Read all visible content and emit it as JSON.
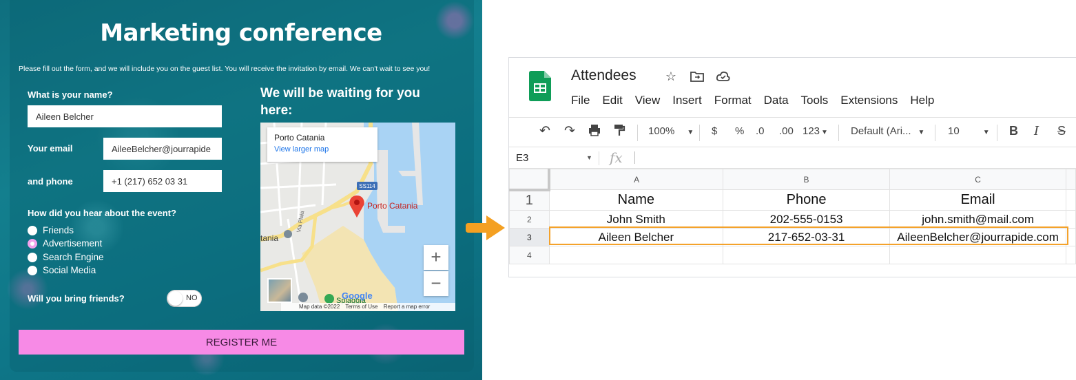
{
  "form": {
    "title": "Marketing conference",
    "subtitle": "Please fill out the form, and we will include you on the guest list. You will receive the invitation by email. We can't wait to see you!",
    "name_label": "What is your name?",
    "name_value": "Aileen Belcher",
    "email_label": "Your email",
    "email_value": "AileeBelcher@jourrapide",
    "phone_label": "and phone",
    "phone_value": "+1 (217) 652 03 31",
    "hear_label": "How did you hear about the event?",
    "hear_options": [
      {
        "label": "Friends",
        "checked": false
      },
      {
        "label": "Advertisement",
        "checked": true
      },
      {
        "label": "Search Engine",
        "checked": false
      },
      {
        "label": "Social Media",
        "checked": false
      }
    ],
    "friends_label": "Will you bring friends?",
    "toggle_text": "NO",
    "map_title": "We will be waiting for you here:",
    "register_label": "REGISTER ME",
    "accent_color": "#f78ae6"
  },
  "map": {
    "place_title": "Porto Catania",
    "larger_map_link": "View larger map",
    "pin_label": "Porto Catania",
    "road_badge": "SS114",
    "street_label": "Via Plaia",
    "left_label": "tania",
    "poi_label": "Spiaggia",
    "zoom_in": "+",
    "zoom_out": "−",
    "google_logo": "Google",
    "footer": {
      "data": "Map data ©2022",
      "terms": "Terms of Use",
      "report": "Report a map error"
    }
  },
  "sheets": {
    "doc_title": "Attendees",
    "title_icons": [
      "star-icon",
      "move-folder-icon",
      "cloud-status-icon"
    ],
    "menu": [
      "File",
      "Edit",
      "View",
      "Insert",
      "Format",
      "Data",
      "Tools",
      "Extensions",
      "Help"
    ],
    "toolbar": {
      "zoom": "100%",
      "currency": "$",
      "percent": "%",
      "decrease_decimal": ".0",
      "increase_decimal": ".00",
      "more_formats": "123",
      "font": "Default (Ari...",
      "font_size": "10",
      "bold": "B",
      "italic": "I",
      "strikethrough": "S"
    },
    "name_box": "E3",
    "fx": "fx",
    "columns": [
      "A",
      "B",
      "C"
    ],
    "rows": [
      {
        "num": "1",
        "cells": [
          "Name",
          "Phone",
          "Email"
        ]
      },
      {
        "num": "2",
        "cells": [
          "John Smith",
          "202-555-0153",
          "john.smith@mail.com"
        ]
      },
      {
        "num": "3",
        "cells": [
          "Aileen Belcher",
          "217-652-03-31",
          "AileenBelcher@jourrapide.com"
        ]
      },
      {
        "num": "4",
        "cells": [
          "",
          "",
          ""
        ]
      }
    ],
    "selection_color": "#f4a22b",
    "logo_color": "#0f9d58"
  },
  "arrow_color": "#f4a022"
}
